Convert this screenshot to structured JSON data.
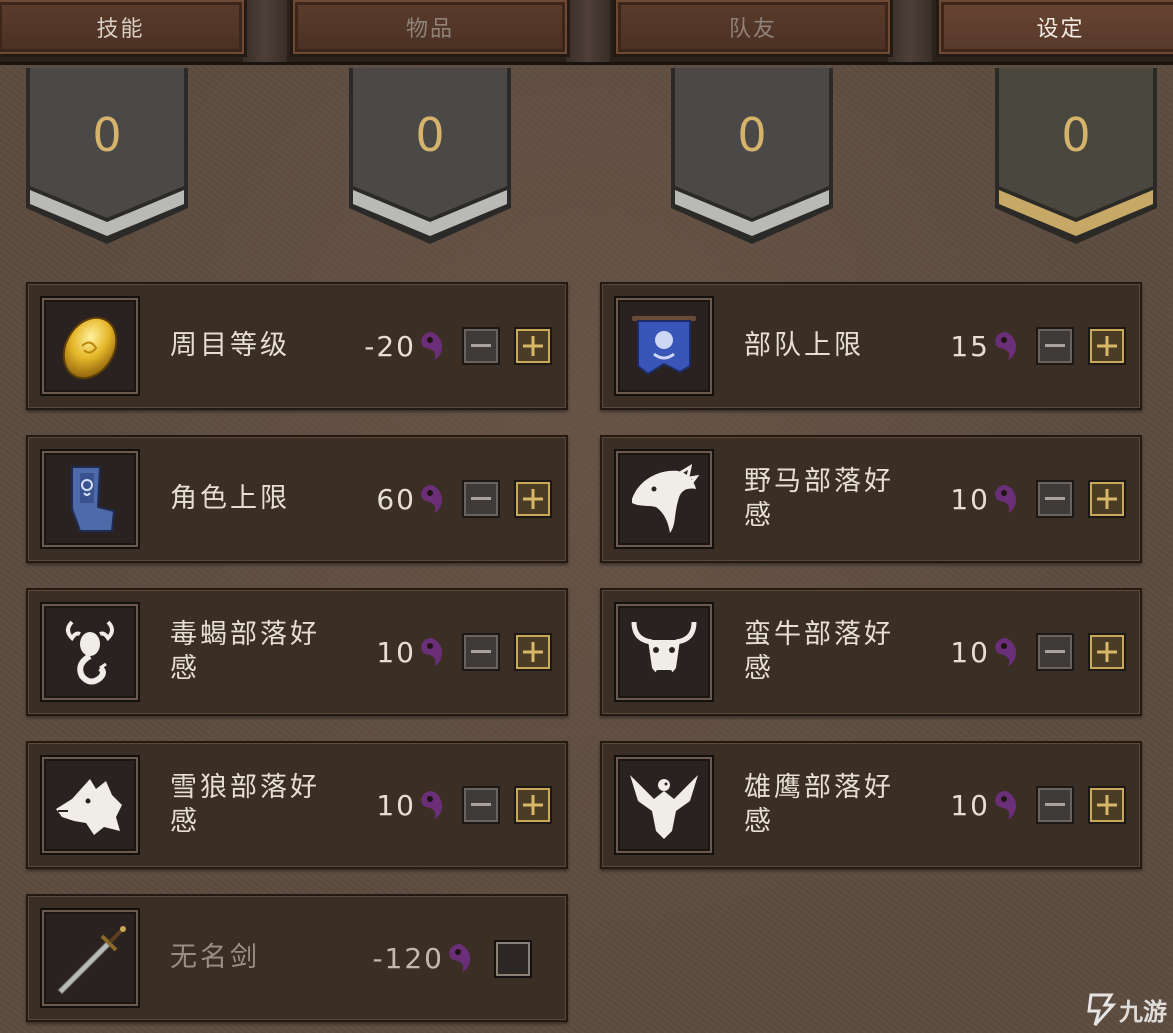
{
  "tabs": [
    {
      "label": "技能",
      "state": "normal"
    },
    {
      "label": "物品",
      "state": "dim"
    },
    {
      "label": "队友",
      "state": "dim"
    },
    {
      "label": "设定",
      "state": "active"
    }
  ],
  "banners": [
    {
      "value": "0",
      "trim": "silver"
    },
    {
      "value": "0",
      "trim": "silver"
    },
    {
      "value": "0",
      "trim": "silver"
    },
    {
      "value": "0",
      "trim": "gold"
    }
  ],
  "options": [
    {
      "label": "周目等级",
      "value": "-20",
      "icon": "golden-egg-icon",
      "control": "stepper"
    },
    {
      "label": "部队上限",
      "value": "15",
      "icon": "blue-banner-icon",
      "control": "stepper"
    },
    {
      "label": "角色上限",
      "value": "60",
      "icon": "throne-icon",
      "control": "stepper"
    },
    {
      "label": "野马部落好感",
      "value": "10",
      "icon": "horse-head-icon",
      "control": "stepper"
    },
    {
      "label": "毒蝎部落好感",
      "value": "10",
      "icon": "scorpion-icon",
      "control": "stepper"
    },
    {
      "label": "蛮牛部落好感",
      "value": "10",
      "icon": "bull-head-icon",
      "control": "stepper"
    },
    {
      "label": "雪狼部落好感",
      "value": "10",
      "icon": "wolf-head-icon",
      "control": "stepper"
    },
    {
      "label": "雄鹰部落好感",
      "value": "10",
      "icon": "eagle-icon",
      "control": "stepper"
    },
    {
      "label": "无名剑",
      "value": "-120",
      "icon": "sword-icon",
      "control": "checkbox",
      "checked": false
    }
  ],
  "currency_icon": "yin-soul-icon",
  "colors": {
    "banner_number": "#d6b36a",
    "plus_border": "#c9a95a",
    "currency": "#6b2f7a"
  },
  "watermark": {
    "text": "九游"
  }
}
